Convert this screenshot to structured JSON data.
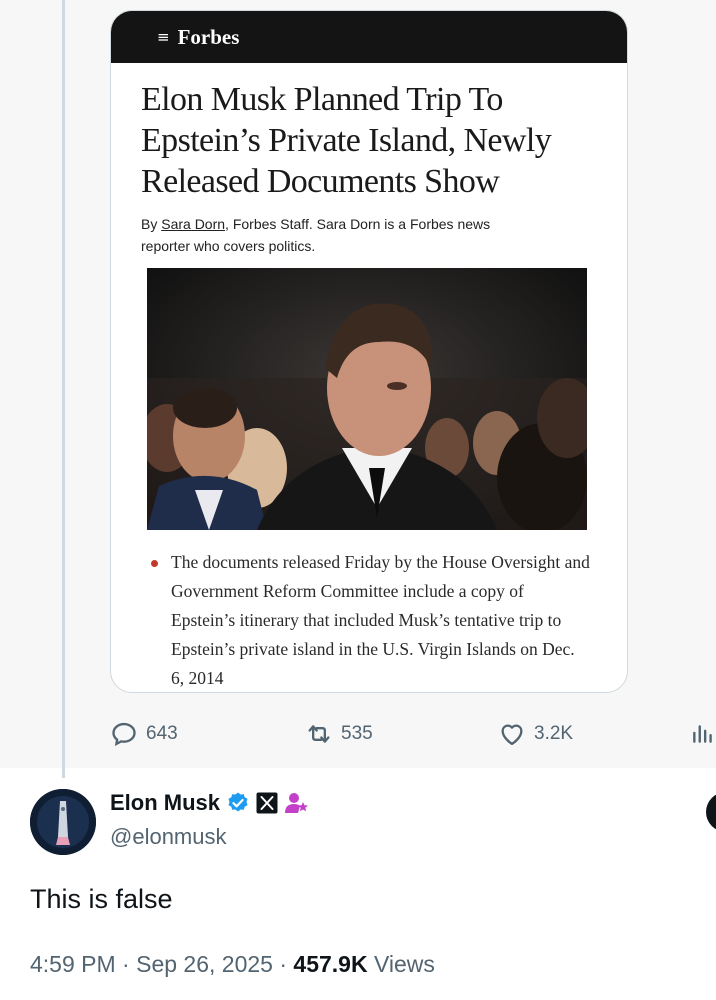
{
  "quoted_post": {
    "publication": "Forbes",
    "menu_icon": "menu-search-icon",
    "headline": "Elon Musk Planned Trip To Epstein’s Private Island, Newly Released Documents Show",
    "byline_prefix": "By ",
    "author": "Sara Dorn",
    "byline_rest": ", Forbes Staff.  Sara Dorn is a Forbes news reporter who covers politics.",
    "bullet_text": "The documents released Friday by the House Oversight and Government Reform Committee include a copy of Epstein’s itinerary that included Musk’s tentative trip to Epstein’s private island in the U.S. Virgin Islands on Dec. 6, 2014",
    "bullet_color": "#c0392b"
  },
  "engagement": {
    "replies": "643",
    "reposts": "535",
    "likes": "3.2K",
    "icons": [
      "reply-icon",
      "repost-icon",
      "like-icon",
      "analytics-icon"
    ]
  },
  "post": {
    "display_name": "Elon Musk",
    "handle": "@elonmusk",
    "text": "This is false",
    "time": "4:59 PM",
    "separator": " · ",
    "date": "Sep 26, 2025",
    "views_count": "457.9K",
    "views_label": " Views",
    "verified_color": "#1d9bf0",
    "affiliate_icon": "x-logo-icon",
    "badge_icon": "person-star-icon"
  }
}
